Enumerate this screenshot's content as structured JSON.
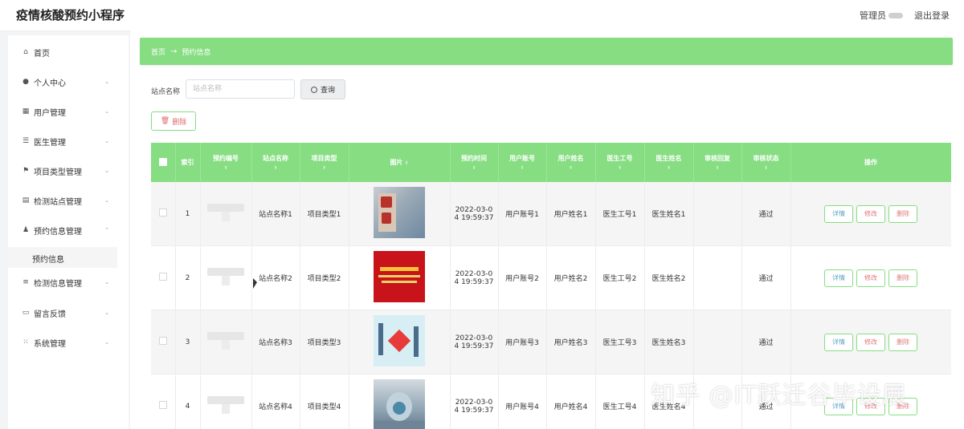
{
  "app": {
    "title": "疫情核酸预约小程序",
    "user_role": "管理员",
    "logout_label": "退出登录"
  },
  "sidebar": {
    "items": [
      {
        "label": "首页",
        "icon": "home-icon",
        "has_arrow": false
      },
      {
        "label": "个人中心",
        "icon": "person-icon",
        "has_arrow": true
      },
      {
        "label": "用户管理",
        "icon": "grid-icon",
        "has_arrow": true
      },
      {
        "label": "医生管理",
        "icon": "list-icon",
        "has_arrow": true
      },
      {
        "label": "项目类型管理",
        "icon": "flag-icon",
        "has_arrow": true
      },
      {
        "label": "检测站点管理",
        "icon": "building-icon",
        "has_arrow": true
      },
      {
        "label": "预约信息管理",
        "icon": "user-group-icon",
        "has_arrow": true
      },
      {
        "label": "检测信息管理",
        "icon": "sliders-icon",
        "has_arrow": true
      },
      {
        "label": "留言反馈",
        "icon": "message-icon",
        "has_arrow": true
      },
      {
        "label": "系统管理",
        "icon": "apps-icon",
        "has_arrow": true
      }
    ],
    "submenu": {
      "label": "预约信息"
    }
  },
  "breadcrumb": {
    "home": "首页",
    "separator": "→",
    "current": "预约信息"
  },
  "search": {
    "label": "站点名称",
    "placeholder": "站点名称",
    "button_label": "查询"
  },
  "toolbar": {
    "delete_label": "删除"
  },
  "table": {
    "columns": [
      "索引",
      "预约编号",
      "站点名称",
      "项目类型",
      "图片",
      "预约时间",
      "用户账号",
      "用户姓名",
      "医生工号",
      "医生姓名",
      "审核回复",
      "审核状态",
      "操作"
    ],
    "rows": [
      {
        "index": "1",
        "site": "站点名称1",
        "type": "项目类型1",
        "time_a": "2022-03-0",
        "time_b": "4 19:59:37",
        "account": "用户账号1",
        "name": "用户姓名1",
        "doc_id": "医生工号1",
        "doc_name": "医生姓名1",
        "reply": "",
        "status": "通过"
      },
      {
        "index": "2",
        "site": "站点名称2",
        "type": "项目类型2",
        "time_a": "2022-03-0",
        "time_b": "4 19:59:37",
        "account": "用户账号2",
        "name": "用户姓名2",
        "doc_id": "医生工号2",
        "doc_name": "医生姓名2",
        "reply": "",
        "status": "通过"
      },
      {
        "index": "3",
        "site": "站点名称3",
        "type": "项目类型3",
        "time_a": "2022-03-0",
        "time_b": "4 19:59:37",
        "account": "用户账号3",
        "name": "用户姓名3",
        "doc_id": "医生工号3",
        "doc_name": "医生姓名3",
        "reply": "",
        "status": "通过"
      },
      {
        "index": "4",
        "site": "站点名称4",
        "type": "项目类型4",
        "time_a": "2022-03-0",
        "time_b": "4 19:59:37",
        "account": "用户账号4",
        "name": "用户姓名4",
        "doc_id": "医生工号4",
        "doc_name": "医生姓名4",
        "reply": "",
        "status": "通过"
      }
    ],
    "actions": {
      "detail": "详情",
      "edit": "修改",
      "delete": "删除"
    }
  },
  "watermark": "知乎 @IT跃迁谷毕设展",
  "colors": {
    "accent": "#86dd82",
    "danger": "#e07a7a",
    "info": "#5aa3c4"
  }
}
